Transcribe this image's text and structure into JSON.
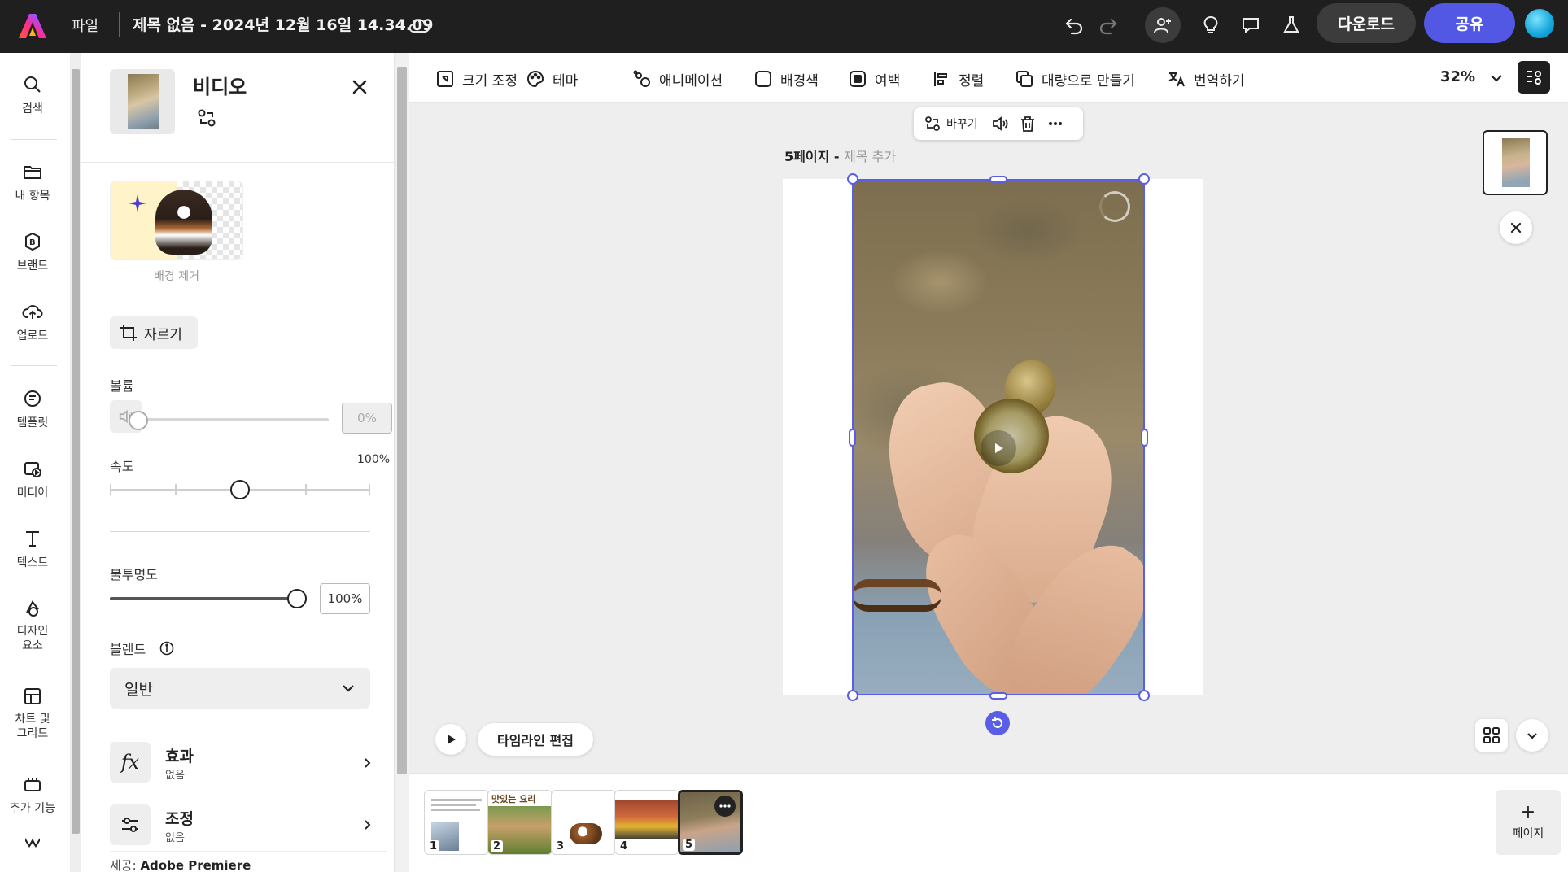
{
  "topbar": {
    "file_menu": "파일",
    "doc_title": "제목 없음 - 2024년 12월 16일 14.34.09",
    "download_label": "다운로드",
    "share_label": "공유",
    "colors": {
      "share": "#5258e4",
      "bar": "#1f1f1f"
    }
  },
  "rail": {
    "items": [
      {
        "label": "검색",
        "icon": "search-icon"
      },
      {
        "label": "내 항목",
        "icon": "folder-icon"
      },
      {
        "label": "브랜드",
        "icon": "brand-icon"
      },
      {
        "label": "업로드",
        "icon": "upload-icon"
      },
      {
        "label": "템플릿",
        "icon": "template-icon"
      },
      {
        "label": "미디어",
        "icon": "media-icon"
      },
      {
        "label": "텍스트",
        "icon": "text-icon"
      },
      {
        "label": "디자인 요소",
        "icon": "shapes-icon"
      },
      {
        "label": "차트 및 그리드",
        "icon": "chart-grid-icon"
      },
      {
        "label": "추가 기능",
        "icon": "addons-icon"
      }
    ]
  },
  "panel": {
    "title": "비디오",
    "bg_remove_label": "배경 제거",
    "crop_label": "자르기",
    "volume_label": "볼륨",
    "volume_value": "0%",
    "volume_level": 0,
    "speed_label": "속도",
    "speed_value": "100%",
    "speed_level": 0.5,
    "opacity_label": "불투명도",
    "opacity_value": "100%",
    "opacity_level": 1.0,
    "blend_label": "블렌드",
    "blend_value": "일반",
    "effects_title": "효과",
    "effects_sub": "없음",
    "adjust_title": "조정",
    "adjust_sub": "없음",
    "provider_prefix": "제공: ",
    "provider_name": "Adobe Premiere"
  },
  "toolbar": {
    "items": [
      {
        "label": "크기 조정",
        "icon": "resize-icon"
      },
      {
        "label": "테마",
        "icon": "palette-icon"
      },
      {
        "label": "애니메이션",
        "icon": "animation-icon"
      },
      {
        "label": "배경색",
        "icon": "bg-color-icon"
      },
      {
        "label": "여백",
        "icon": "padding-icon"
      },
      {
        "label": "정렬",
        "icon": "align-icon"
      },
      {
        "label": "대량으로 만들기",
        "icon": "bulk-create-icon"
      },
      {
        "label": "번역하기",
        "icon": "translate-icon"
      }
    ],
    "zoom": "32%"
  },
  "canvas": {
    "page_label": "5페이지 - ",
    "page_title_placeholder": "제목 추가",
    "float_bar": {
      "replace_label": "바꾸기"
    },
    "timeline_label": "타임라인 편집",
    "selection_color": "#5a5ee6"
  },
  "strip": {
    "pages": [
      {
        "num": "1"
      },
      {
        "num": "2",
        "title": "맛있는 요리"
      },
      {
        "num": "3"
      },
      {
        "num": "4"
      },
      {
        "num": "5",
        "active": true
      }
    ],
    "add_page_label": "페이지"
  }
}
